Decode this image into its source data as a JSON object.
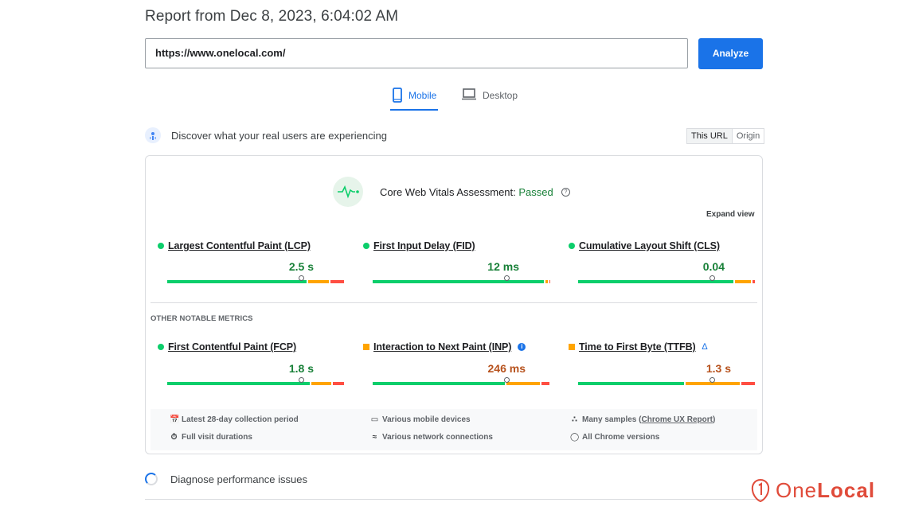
{
  "title": "Report from Dec 8, 2023, 6:04:02 AM",
  "url_input": {
    "value": "https://www.onelocal.com/"
  },
  "analyze_label": "Analyze",
  "tabs": [
    {
      "label": "Mobile",
      "active": true,
      "icon": "mobile-icon"
    },
    {
      "label": "Desktop",
      "active": false,
      "icon": "desktop-icon"
    }
  ],
  "field_section": {
    "heading": "Discover what your real users are experiencing",
    "toggle": [
      "This URL",
      "Origin"
    ],
    "toggle_active": "This URL"
  },
  "cwv": {
    "label": "Core Web Vitals Assessment:",
    "status": "Passed",
    "status_color": "#188038",
    "expand_label": "Expand view"
  },
  "core_metrics": [
    {
      "name": "Largest Contentful Paint (LCP)",
      "value": "2.5 s",
      "rating": "good",
      "distribution": [
        0.75,
        0.12,
        0.08
      ],
      "marker": 0.75
    },
    {
      "name": "First Input Delay (FID)",
      "value": "12 ms",
      "rating": "good",
      "distribution": [
        0.96,
        0.02,
        0.01
      ],
      "marker": 0.75
    },
    {
      "name": "Cumulative Layout Shift (CLS)",
      "value": "0.04",
      "rating": "good",
      "distribution": [
        0.87,
        0.1,
        0.02
      ],
      "marker": 0.75
    }
  ],
  "other_heading": "OTHER NOTABLE METRICS",
  "other_metrics": [
    {
      "name": "First Contentful Paint (FCP)",
      "value": "1.8 s",
      "rating": "good",
      "distribution": [
        0.81,
        0.12,
        0.07
      ],
      "marker": 0.75
    },
    {
      "name": "Interaction to Next Paint (INP)",
      "value": "246 ms",
      "rating": "needs-improvement",
      "distribution": [
        0.72,
        0.19,
        0.05
      ],
      "marker": 0.75
    },
    {
      "name": "Time to First Byte (TTFB)",
      "value": "1.3 s",
      "rating": "needs-improvement",
      "distribution": [
        0.58,
        0.3,
        0.08
      ],
      "marker": 0.75
    }
  ],
  "footer_items": [
    {
      "icon": "calendar-icon",
      "text": "Latest 28-day collection period"
    },
    {
      "icon": "devices-icon",
      "text": "Various mobile devices"
    },
    {
      "icon": "people-icon",
      "text": "Many samples (",
      "link": "Chrome UX Report",
      "after": ")"
    },
    {
      "icon": "timer-icon",
      "text": "Full visit durations"
    },
    {
      "icon": "wifi-icon",
      "text": "Various network connections"
    },
    {
      "icon": "chrome-icon",
      "text": "All Chrome versions"
    }
  ],
  "diagnose": "Diagnose performance issues",
  "logo": {
    "text_light": "One",
    "text_bold": "Local",
    "color": "#e04b3a"
  },
  "colors": {
    "good": "#0cce6b",
    "needs_improvement": "#ffa400",
    "poor": "#ff4e42",
    "accent": "#1a73e8"
  }
}
